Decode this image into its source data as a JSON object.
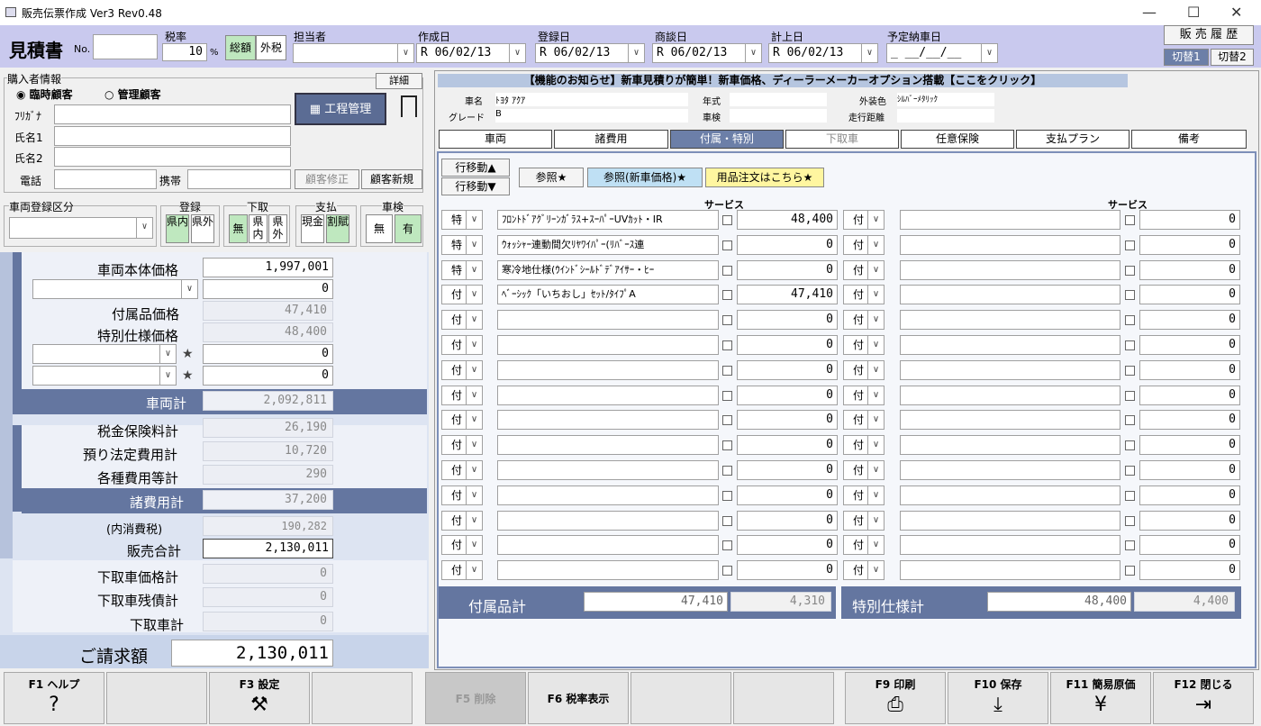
{
  "window": {
    "title": "販売伝票作成 Ver3 Rev0.48",
    "min": "—",
    "max": "☐",
    "close": "✕"
  },
  "header": {
    "doc_title": "見積書",
    "no_label": "No.",
    "no_value": "",
    "tax_label": "税率",
    "tax_value": "10",
    "tax_unit": "%",
    "total_btn": "総額",
    "exclude_btn": "外税",
    "staff_label": "担当者",
    "staff_value": "",
    "date_create_label": "作成日",
    "date_create": "R 06/02/13",
    "date_reg_label": "登録日",
    "date_reg": "R 06/02/13",
    "date_nego_label": "商談日",
    "date_nego": "R 06/02/13",
    "date_book_label": "計上日",
    "date_book": "R 06/02/13",
    "date_deliv_label": "予定納車日",
    "date_deliv": "_ __/__/__",
    "history_btn": "販 売 履 歴",
    "switch1": "切替1",
    "switch2": "切替2"
  },
  "buyer": {
    "section": "購入者情報",
    "detail_btn": "詳細",
    "radio1": "臨時顧客",
    "radio2": "管理顧客",
    "kana_label": "ﾌﾘｶﾞﾅ",
    "name1_label": "氏名1",
    "name2_label": "氏名2",
    "tel_label": "電話",
    "mobile_label": "携帯",
    "process_btn": "工程管理",
    "modify_btn": "顧客修正",
    "new_btn": "顧客新規"
  },
  "options": {
    "reg_class_label": "車両登録区分",
    "reg_label": "登録",
    "reg_in": "県内",
    "reg_out": "県外",
    "trade_label": "下取",
    "trade_none": "無",
    "trade_in": "県内",
    "trade_out": "県外",
    "pay_label": "支払",
    "pay_cash": "現金",
    "pay_loan": "割賦",
    "inspect_label": "車検",
    "inspect_no": "無",
    "inspect_yes": "有"
  },
  "summary": {
    "base_price_label": "車両本体価格",
    "base_price": "1,997,001",
    "disc_value": "0",
    "acc_label": "付属品価格",
    "acc_value": "47,410",
    "spec_label": "特別仕様価格",
    "spec_value": "48,400",
    "star1_value": "0",
    "star2_value": "0",
    "star": "★",
    "vehicle_total_label": "車両計",
    "vehicle_total": "2,092,811",
    "tax_ins_label": "税金保険料計",
    "tax_ins": "26,190",
    "legal_label": "預り法定費用計",
    "legal": "10,720",
    "misc_label": "各種費用等計",
    "misc": "290",
    "fees_total_label": "諸費用計",
    "fees_total": "37,200",
    "inc_tax_label": "(内消費税)",
    "inc_tax": "190,282",
    "sales_total_label": "販売合計",
    "sales_total": "2,130,011",
    "trade_price_label": "下取車価格計",
    "trade_price": "0",
    "trade_rem_label": "下取車残債計",
    "trade_rem": "0",
    "trade_total_label": "下取車計",
    "trade_total": "0",
    "invoice_label": "ご請求額",
    "invoice": "2,130,011"
  },
  "notice": "【機能のお知らせ】新車見積りが簡単！新車価格、ディーラーメーカーオプション搭載【ここをクリック】",
  "car": {
    "name_label": "車名",
    "name": "ﾄﾖﾀ ｱｸｱ",
    "grade_label": "グレード",
    "grade": "B",
    "year_label": "年式",
    "year": "",
    "inspection_label": "車検",
    "inspection": "",
    "color_label": "外装色",
    "color": "ｼﾙﾊﾞｰﾒﾀﾘｯｸ",
    "mileage_label": "走行距離",
    "mileage": ""
  },
  "tabs": [
    "車両",
    "諸費用",
    "付属・特別",
    "下取車",
    "任意保険",
    "支払プラン",
    "備考"
  ],
  "toolbar": {
    "move_up": "行移動▲",
    "move_down": "行移動▼",
    "ref": "参照★",
    "ref_new": "参照(新車価格)★",
    "order": "用品注文はこちら★",
    "service": "サービス"
  },
  "left_rows": [
    {
      "type": "特",
      "name": "ﾌﾛﾝﾄﾄﾞｱｸﾞﾘｰﾝｶﾞﾗｽ+ｽｰﾊﾟｰUVｶｯﾄ・IR",
      "price": "48,400"
    },
    {
      "type": "特",
      "name": "ｳｫｯｼｬｰ連動間欠ﾘﾔﾜｲﾊﾟｰ(ﾘﾊﾞｰｽ連",
      "price": "0"
    },
    {
      "type": "特",
      "name": "寒冷地仕様(ｳｲﾝﾄﾞｼｰﾙﾄﾞﾃﾞｱｲｻｰ・ﾋｰ",
      "price": "0"
    },
    {
      "type": "付",
      "name": "ﾍﾞｰｼｯｸ「いちおし」ｾｯﾄ/ﾀｲﾌﾟA",
      "price": "47,410"
    },
    {
      "type": "付",
      "name": "",
      "price": "0"
    },
    {
      "type": "付",
      "name": "",
      "price": "0"
    },
    {
      "type": "付",
      "name": "",
      "price": "0"
    },
    {
      "type": "付",
      "name": "",
      "price": "0"
    },
    {
      "type": "付",
      "name": "",
      "price": "0"
    },
    {
      "type": "付",
      "name": "",
      "price": "0"
    },
    {
      "type": "付",
      "name": "",
      "price": "0"
    },
    {
      "type": "付",
      "name": "",
      "price": "0"
    },
    {
      "type": "付",
      "name": "",
      "price": "0"
    },
    {
      "type": "付",
      "name": "",
      "price": "0"
    },
    {
      "type": "付",
      "name": "",
      "price": "0"
    }
  ],
  "right_rows_type": "付",
  "right_rows_price": "0",
  "totals": {
    "acc_label": "付属品計",
    "acc_total": "47,410",
    "acc_tax": "4,310",
    "spec_label": "特別仕様計",
    "spec_total": "48,400",
    "spec_tax": "4,400"
  },
  "fkeys": [
    {
      "key": "F1 ヘルプ",
      "icon": "?"
    },
    {
      "key": "",
      "icon": ""
    },
    {
      "key": "F3 設定",
      "icon": "⚒"
    },
    {
      "key": "",
      "icon": ""
    },
    {
      "key": "F5 削除",
      "icon": ""
    },
    {
      "key": "F6 税率表示",
      "icon": ""
    },
    {
      "key": "",
      "icon": ""
    },
    {
      "key": "",
      "icon": ""
    },
    {
      "key": "F9 印刷",
      "icon": "⎙"
    },
    {
      "key": "F10 保存",
      "icon": "⤓"
    },
    {
      "key": "F11 簡易原価",
      "icon": "¥"
    },
    {
      "key": "F12 閉じる",
      "icon": "⇥"
    }
  ]
}
